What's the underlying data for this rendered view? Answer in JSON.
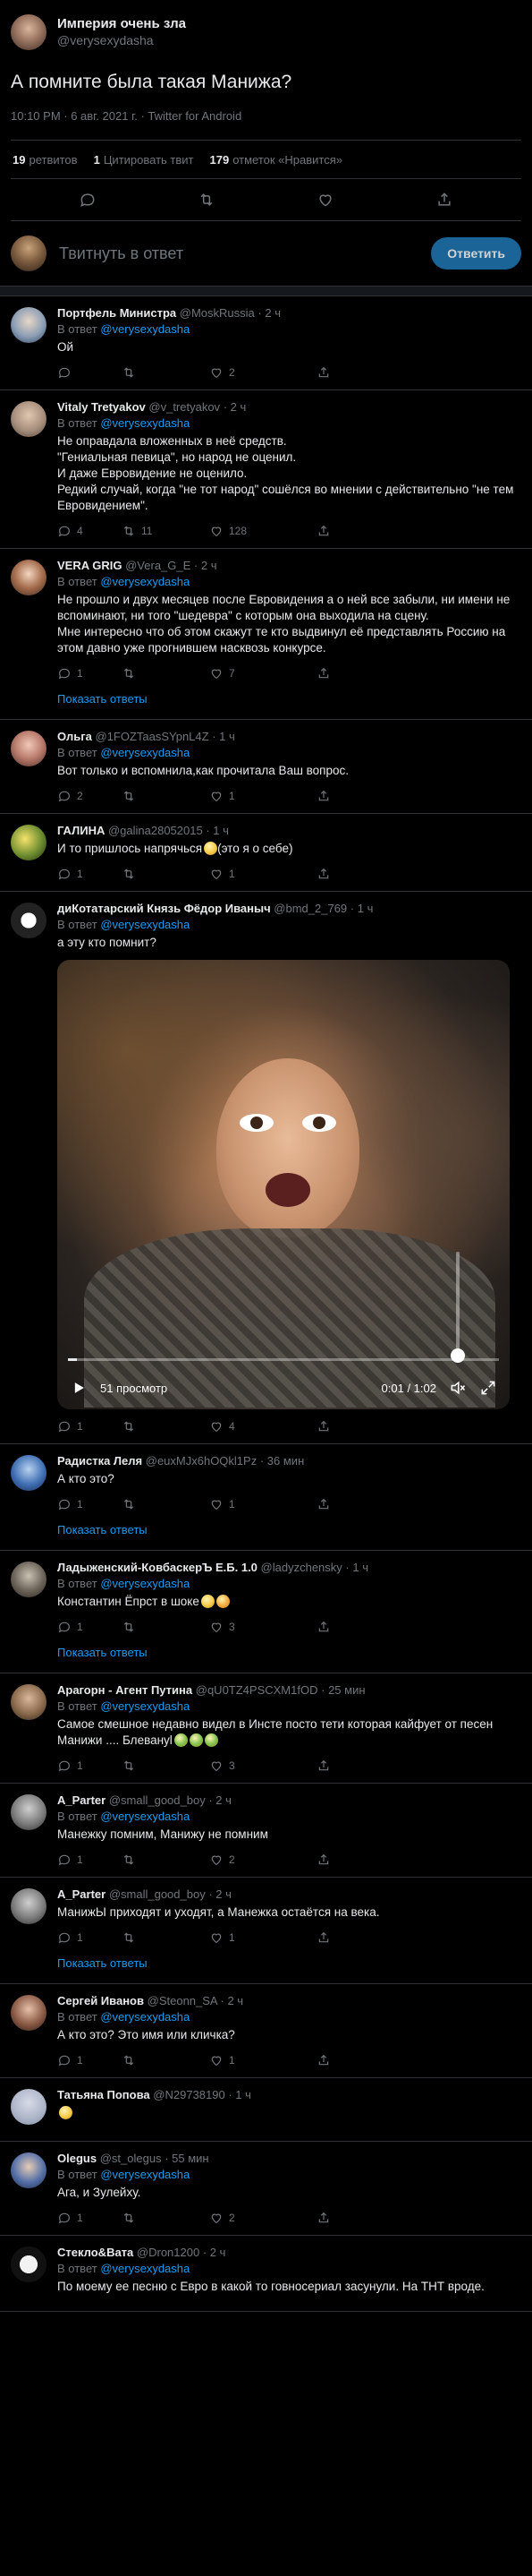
{
  "main": {
    "author_name": "Империя очень зла",
    "author_handle": "@verysexydasha",
    "text": "А помните была такая Манижа?",
    "meta": "10:10 PM · 6 авг. 2021 г. · Twitter for Android",
    "stats": {
      "retweets_count": "19",
      "retweets_label": "ретвитов",
      "quotes_count": "1",
      "quotes_label": "Цитировать твит",
      "likes_count": "179",
      "likes_label": "отметок «Нравится»"
    },
    "reply_placeholder": "Твитнуть в ответ",
    "reply_button": "Ответить"
  },
  "colors": {
    "background": "#000000",
    "text": "#e7e9ea",
    "muted": "#71767b",
    "accent": "#1d9bf0",
    "divider": "#2f3336"
  },
  "in_reply_label": "В ответ",
  "show_more_label": "Показать ответы",
  "replies": [
    {
      "name": "Портфель Министра",
      "handle": "@MoskRussia",
      "time": "2 ч",
      "reply_to": "@verysexydasha",
      "text": "Ой",
      "replies": "",
      "retweets": "",
      "likes": "2",
      "show_more": false
    },
    {
      "name": "Vitaly Tretyakov",
      "handle": "@v_tretyakov",
      "time": "2 ч",
      "reply_to": "@verysexydasha",
      "text": "Не оправдала вложенных в неё средств.\n\"Гениальная певица\", но народ не оценил.\nИ даже Евровидение не оценило.\nРедкий случай, когда \"не тот народ\" сошёлся во мнении с действительно \"не тем Евровидением\".",
      "replies": "4",
      "retweets": "11",
      "likes": "128",
      "show_more": false
    },
    {
      "name": "VERA GRIG",
      "handle": "@Vera_G_E",
      "time": "2 ч",
      "reply_to": "@verysexydasha",
      "text": "Не прошло и двух месяцев после Евровидения а о ней все забыли, ни имени не вспоминают, ни того \"шедевра\" с которым она выходила на сцену.\nМне интересно что об этом скажут те кто выдвинул её представлять Россию на этом давно уже прогнившем насквозь конкурсе.",
      "replies": "1",
      "retweets": "",
      "likes": "7",
      "show_more": true
    },
    {
      "name": "Ольга",
      "handle": "@1FOZTaasSYpnL4Z",
      "time": "1 ч",
      "reply_to": "@verysexydasha",
      "text": "Вот только и вспомнила,как прочитала Ваш вопрос.",
      "replies": "2",
      "retweets": "",
      "likes": "1",
      "show_more": false
    },
    {
      "name": "ГАЛИНА",
      "handle": "@galina28052015",
      "time": "1 ч",
      "reply_to": "",
      "text": "И то пришлось напрячься",
      "text_suffix": "(это я о себе)",
      "emoji": "thinking-face",
      "replies": "1",
      "retweets": "",
      "likes": "1",
      "show_more": false
    },
    {
      "name": "диКотатарский Князь Фёдор Иваныч",
      "handle": "@bmd_2_769",
      "time": "1 ч",
      "reply_to": "@verysexydasha",
      "text": "а эту кто помнит?",
      "video": true,
      "replies": "1",
      "retweets": "",
      "likes": "4",
      "show_more": false
    },
    {
      "name": "Радистка Леля",
      "handle": "@euxMJx6hOQkl1Pz",
      "time": "36 мин",
      "reply_to": "",
      "text": "А кто это?",
      "replies": "1",
      "retweets": "",
      "likes": "1",
      "show_more": true
    },
    {
      "name": "Ладыженский-КовбаскерЪ Е.Б. 1.0",
      "handle": "@ladyzchensky",
      "time": "1 ч",
      "reply_to": "@verysexydasha",
      "text": "Константин Ёпрст в шоке",
      "emoji": "two-emojis",
      "replies": "1",
      "retweets": "",
      "likes": "3",
      "show_more": true
    },
    {
      "name": "Арагорн - Агент Путина",
      "handle": "@qU0TZ4PSCXM1fOD",
      "time": "25 мин",
      "reply_to": "@verysexydasha",
      "text": "Самое смешное недавно видел в Инсте посто тети которая кайфует от песен Манижи .... Блевануl",
      "emoji": "three-sick",
      "replies": "1",
      "retweets": "",
      "likes": "3",
      "show_more": false
    },
    {
      "name": "A_Parter",
      "handle": "@small_good_boy",
      "time": "2 ч",
      "reply_to": "@verysexydasha",
      "text": "Манежку помним, Манижу не помним",
      "replies": "1",
      "retweets": "",
      "likes": "2",
      "show_more": false
    },
    {
      "name": "A_Parter",
      "handle": "@small_good_boy",
      "time": "2 ч",
      "reply_to": "",
      "text": "МанижЫ приходят и уходят, а Манежка остаётся на века.",
      "replies": "1",
      "retweets": "",
      "likes": "1",
      "show_more": true
    },
    {
      "name": "Сергей Иванов",
      "handle": "@Steonn_SA",
      "time": "2 ч",
      "reply_to": "@verysexydasha",
      "text": "А кто это? Это имя или кличка?",
      "replies": "1",
      "retweets": "",
      "likes": "1",
      "show_more": false
    },
    {
      "name": "Татьяна Попова",
      "handle": "@N29738190",
      "time": "1 ч",
      "reply_to": "",
      "text": "",
      "emoji": "smiley",
      "replies": "",
      "retweets": "",
      "likes": "",
      "show_more": false,
      "no_actions": true
    },
    {
      "name": "Olegus",
      "handle": "@st_olegus",
      "time": "55 мин",
      "reply_to": "@verysexydasha",
      "text": "Ага, и Зулейху.",
      "replies": "1",
      "retweets": "",
      "likes": "2",
      "show_more": false
    },
    {
      "name": "Стекло&Вата",
      "handle": "@Dron1200",
      "time": "2 ч",
      "reply_to": "@verysexydasha",
      "text": "По моему ее песню с Евро в какой то говносериал засунули. На ТНТ вроде.",
      "replies": "",
      "retweets": "",
      "likes": "",
      "show_more": false,
      "no_actions": true
    }
  ],
  "video": {
    "views": "51 просмотр",
    "time": "0:01 / 1:02",
    "progress": 0.02
  }
}
